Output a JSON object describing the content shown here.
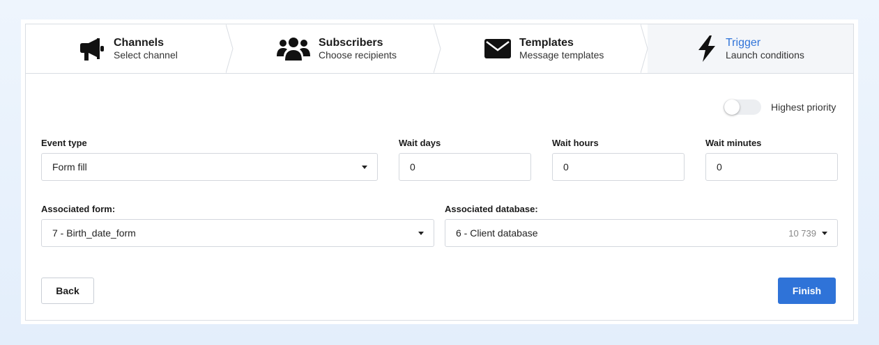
{
  "steps": [
    {
      "title": "Channels",
      "subtitle": "Select channel",
      "icon": "megaphone-icon"
    },
    {
      "title": "Subscribers",
      "subtitle": "Choose recipients",
      "icon": "users-icon"
    },
    {
      "title": "Templates",
      "subtitle": "Message templates",
      "icon": "envelope-icon"
    },
    {
      "title": "Trigger",
      "subtitle": "Launch conditions",
      "icon": "lightning-icon",
      "active": true
    }
  ],
  "priority": {
    "label": "Highest priority",
    "on": false
  },
  "event_type": {
    "label": "Event type",
    "value": "Form fill"
  },
  "wait_days": {
    "label": "Wait days",
    "value": "0"
  },
  "wait_hours": {
    "label": "Wait hours",
    "value": "0"
  },
  "wait_minutes": {
    "label": "Wait minutes",
    "value": "0"
  },
  "assoc_form": {
    "label": "Associated form:",
    "value": "7 - Birth_date_form"
  },
  "assoc_db": {
    "label": "Associated database:",
    "value": "6 - Client database",
    "count": "10 739"
  },
  "buttons": {
    "back": "Back",
    "finish": "Finish"
  },
  "colors": {
    "accent": "#2f73d8",
    "active_step_bg": "#f4f6f9",
    "border": "#d9dde3"
  }
}
